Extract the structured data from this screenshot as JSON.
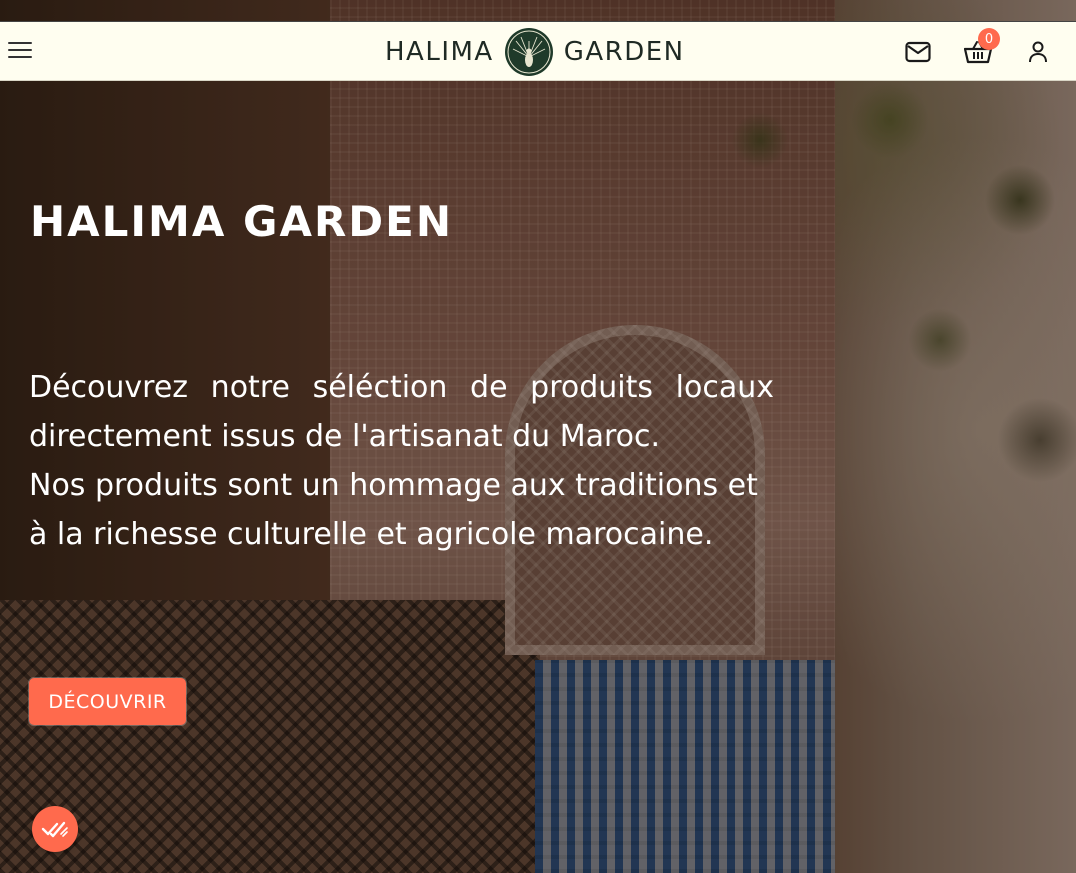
{
  "header": {
    "logo_left": "HALIMA",
    "logo_right": "GARDEN",
    "cart_count": "0",
    "icons": {
      "menu": "hamburger-menu-icon",
      "mail": "envelope-icon",
      "cart": "basket-icon",
      "account": "user-icon"
    }
  },
  "hero": {
    "title": "HALIMA GARDEN",
    "paragraph_1": "Découvrez notre séléction de produits locaux directement issus de l'artisanat du Maroc.",
    "paragraph_2": "Nos produits sont un hommage aux traditions et à la richesse culturelle et agricole marocaine.",
    "cta_label": "DÉCOUVRIR"
  },
  "floating_button": {
    "icon": "double-check-icon"
  },
  "colors": {
    "accent": "#ff6a4d",
    "header_bg": "#fffef0",
    "logo_text": "#1f2a24"
  }
}
